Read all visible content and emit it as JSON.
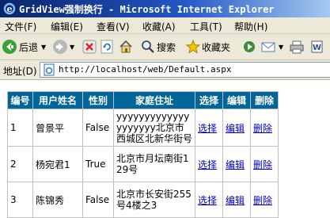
{
  "window": {
    "title": "GridView强制换行 - Microsoft Internet Explorer"
  },
  "menu": [
    "文件(F)",
    "编辑(E)",
    "查看(V)",
    "收藏(A)",
    "工具(T)",
    "帮助(H)"
  ],
  "toolbar": {
    "back_label": "后退",
    "search_label": "搜索",
    "favorites_label": "收藏夹"
  },
  "address": {
    "label": "地址(D)",
    "url": "http://localhost/web/Default.aspx"
  },
  "grid": {
    "headers": [
      "编号",
      "用户姓名",
      "性别",
      "家庭住址",
      "选择",
      "编辑",
      "删除"
    ],
    "rows": [
      {
        "id": "1",
        "name": "曾景平",
        "sex": "False",
        "address": "yyyyyyyyyyyyyyyyyyyy北京市西城区北新华街号",
        "select": "选择",
        "edit": "编辑",
        "delete": "删除"
      },
      {
        "id": "2",
        "name": "杨宛君1",
        "sex": "True",
        "address": "北京市月坛南街129号",
        "select": "选择",
        "edit": "编辑",
        "delete": "删除"
      },
      {
        "id": "3",
        "name": "陈锦秀",
        "sex": "False",
        "address": "北京市长安街255号4楼之3",
        "select": "选择",
        "edit": "编辑",
        "delete": "删除"
      }
    ]
  }
}
